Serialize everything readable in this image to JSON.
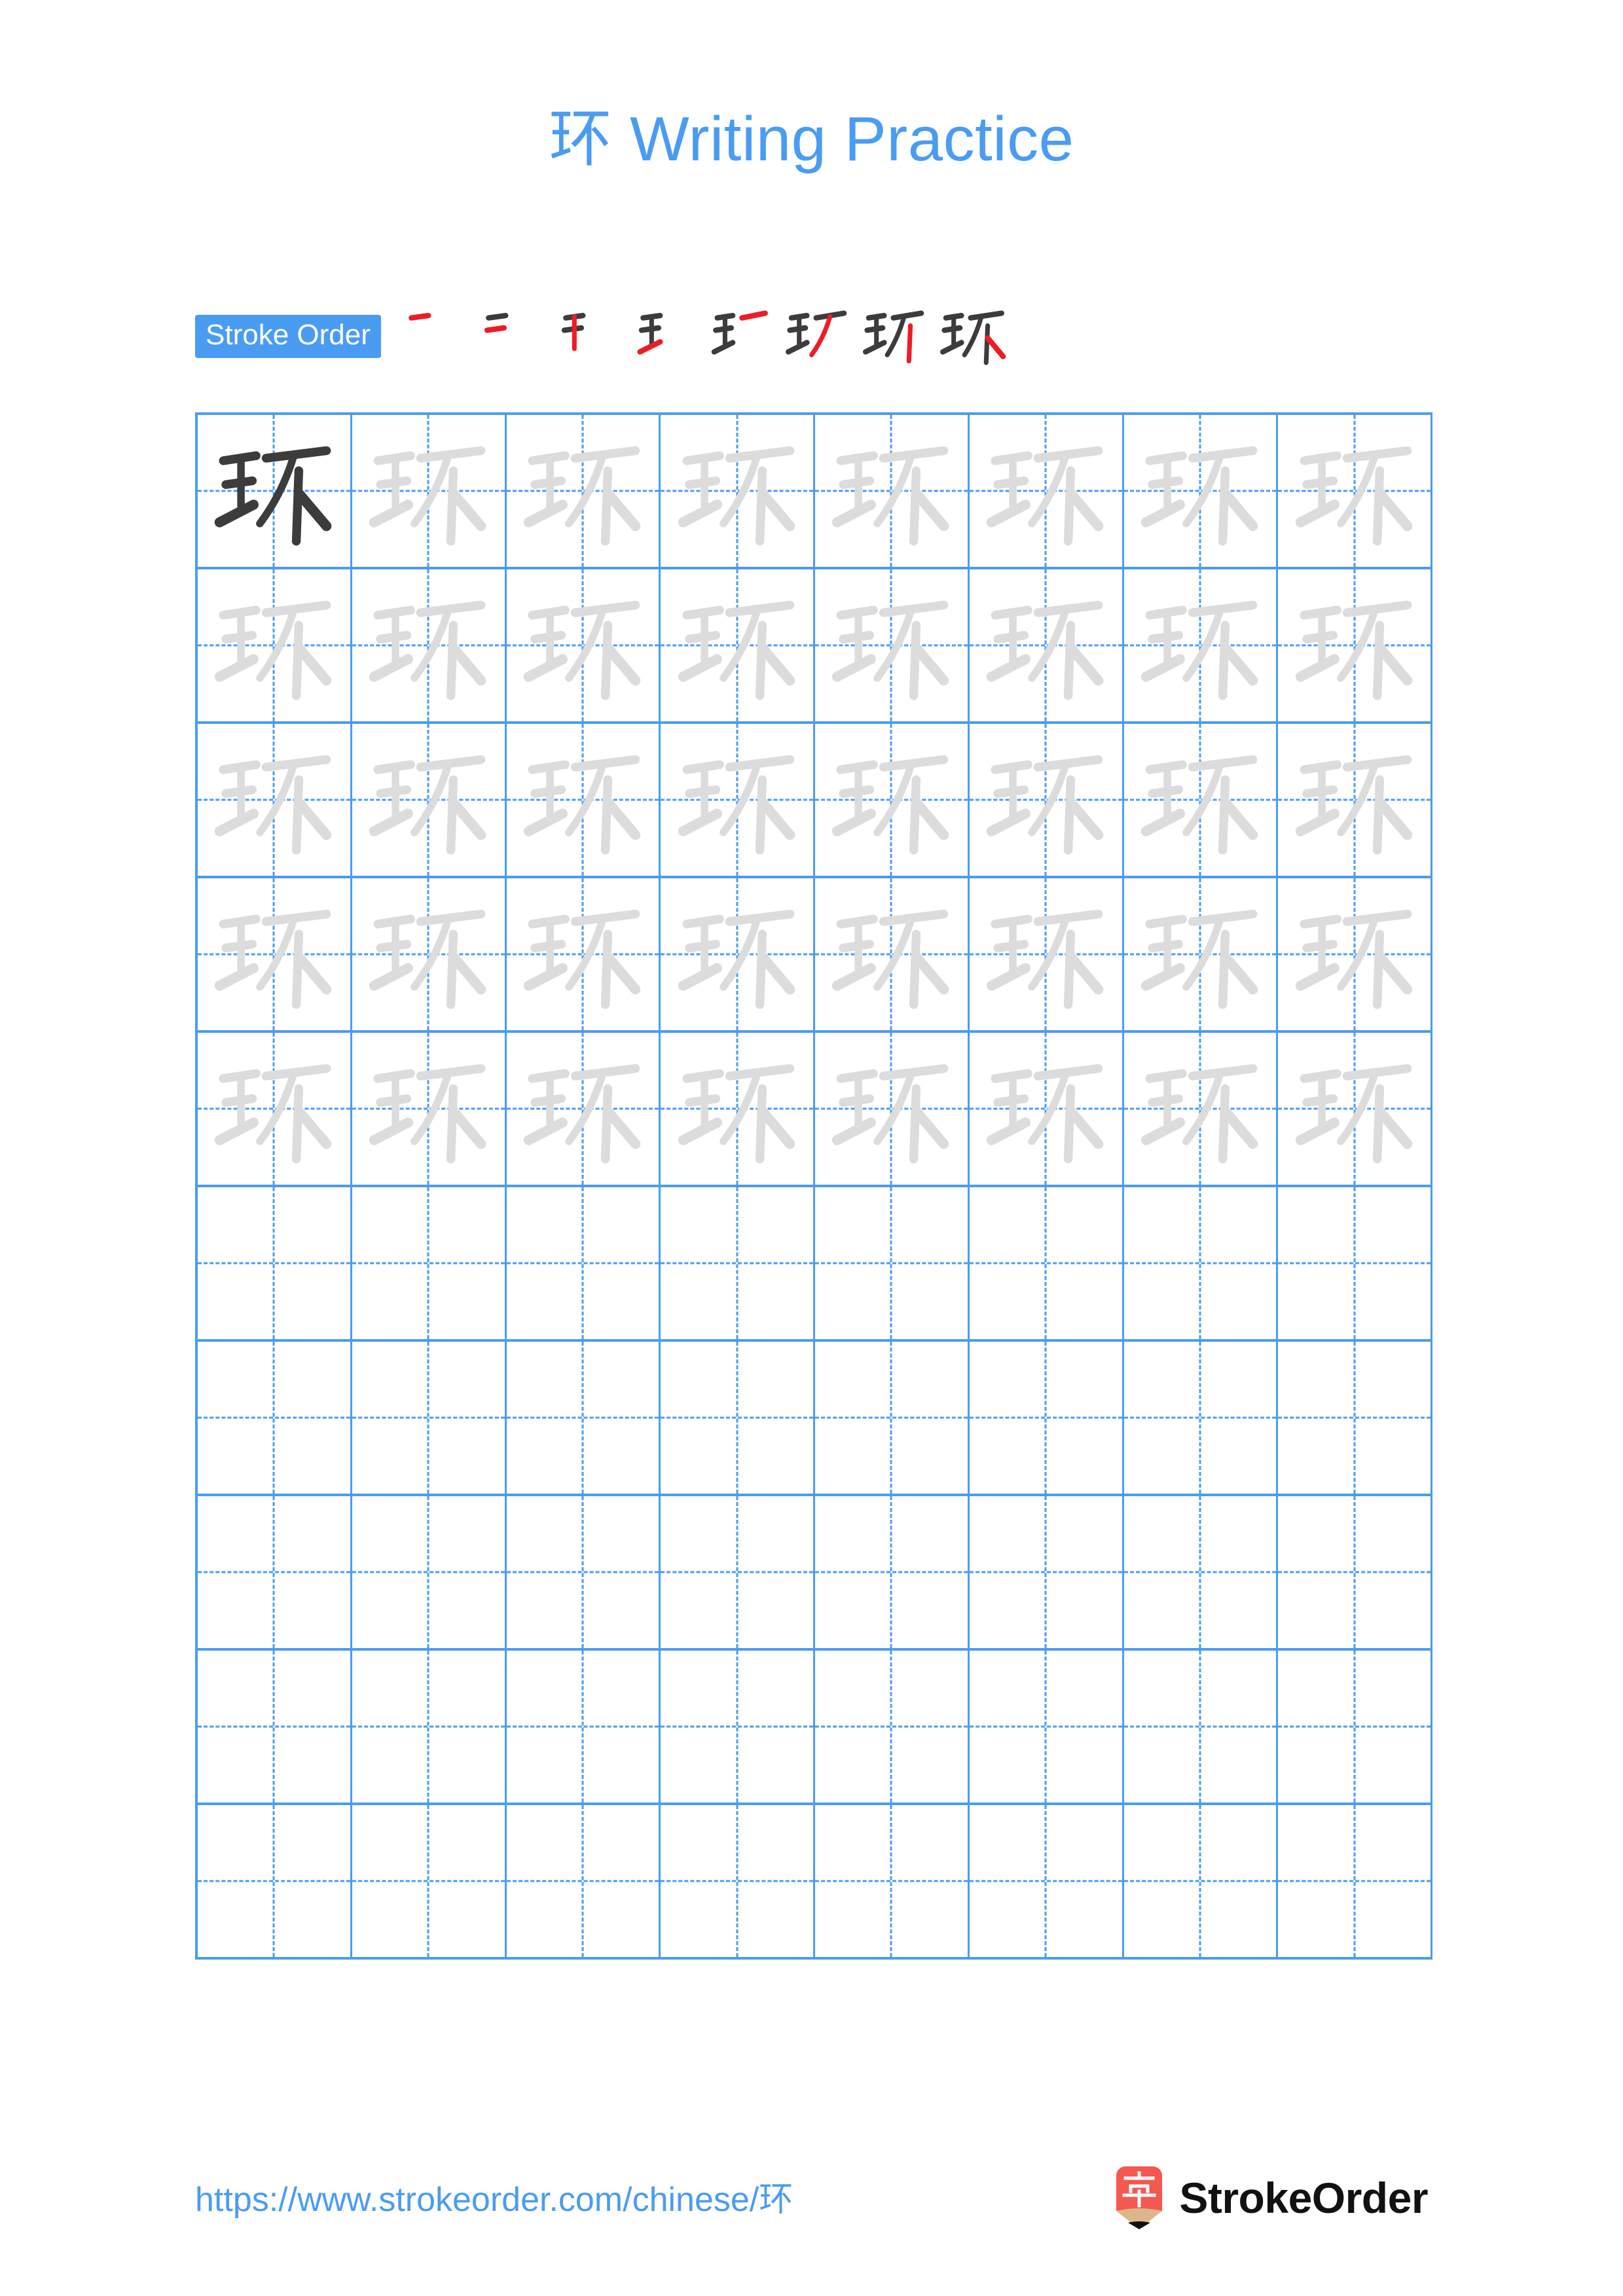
{
  "page": {
    "character": "环",
    "title": "环 Writing Practice",
    "background_color": "#ffffff",
    "accent_color": "#4a9cf2",
    "stroke_highlight_color": "#ee1c25",
    "stroke_ink_color": "#3c3c3c",
    "trace_color": "#dcdcdc"
  },
  "stroke_order": {
    "badge_label": "Stroke Order",
    "total_strokes": 8,
    "steps": [
      {
        "index": 1,
        "strokes_shown": 1,
        "new_stroke": "héng (horizontal)",
        "glyph": "一"
      },
      {
        "index": 2,
        "strokes_shown": 2,
        "new_stroke": "héng (horizontal)",
        "glyph": "二"
      },
      {
        "index": 3,
        "strokes_shown": 3,
        "new_stroke": "shù (vertical)",
        "glyph": "干"
      },
      {
        "index": 4,
        "strokes_shown": 4,
        "new_stroke": "tí (rising)",
        "glyph": "王"
      },
      {
        "index": 5,
        "strokes_shown": 5,
        "new_stroke": "héng (horizontal)",
        "glyph": "王一"
      },
      {
        "index": 6,
        "strokes_shown": 6,
        "new_stroke": "piě (left-falling)",
        "glyph": "玙"
      },
      {
        "index": 7,
        "strokes_shown": 7,
        "new_stroke": "shù (vertical)",
        "glyph": "玡"
      },
      {
        "index": 8,
        "strokes_shown": 8,
        "new_stroke": "nà (right-falling)",
        "glyph": "环"
      }
    ]
  },
  "grid": {
    "columns": 8,
    "rows": 10,
    "rows_with_characters": 5,
    "empty_rows": 5,
    "first_cell_style": "solid-dark",
    "trace_cell_style": "light-gray",
    "guide_lines": "dashed-cross"
  },
  "footer": {
    "url": "https://www.strokeorder.com/chinese/环",
    "brand_name": "StrokeOrder",
    "logo_character": "字",
    "logo_color": "#f4584f",
    "logo_tip_color": "#dcb68b"
  }
}
